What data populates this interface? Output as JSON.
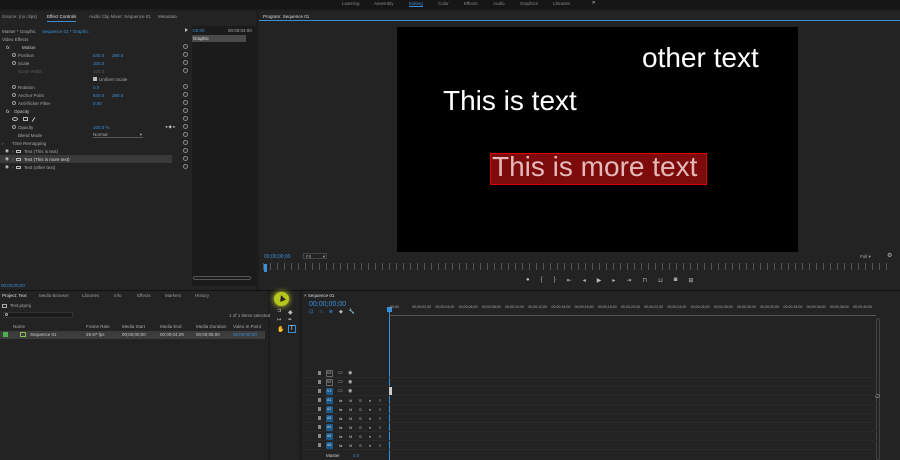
{
  "workspaces": [
    "Learning",
    "Assembly",
    "Editing",
    "Color",
    "Effects",
    "Audio",
    "Graphics",
    "Libraries"
  ],
  "workspaces_more": "»",
  "effect_panel": {
    "tabs": [
      "Source: (no clips)",
      "Effect Controls",
      "Audio Clip Mixer: Sequence 01",
      "Metadata"
    ],
    "master_label": "Master * Graphic",
    "clip_label": "Sequence 01 * Graphic",
    "mini_timecode": ":00:00",
    "mini_timecode_end": "00:00:04:00",
    "mini_clip": "Graphic",
    "section": "Video Effects",
    "motion": "Motion",
    "position": {
      "label": "Position",
      "x": "640.0",
      "y": "360.0"
    },
    "scale": {
      "label": "Scale",
      "value": "100.0"
    },
    "scale_width": {
      "label": "Scale Width",
      "value": "100.0"
    },
    "uniform_scale": "Uniform Scale",
    "rotation": {
      "label": "Rotation",
      "value": "0.0"
    },
    "anchor": {
      "label": "Anchor Point",
      "x": "640.0",
      "y": "360.0"
    },
    "anti_flicker": {
      "label": "Anti-flicker Filter",
      "value": "0.00"
    },
    "opacity": "Opacity",
    "opacity_val": {
      "label": "Opacity",
      "value": "100.0 %"
    },
    "blend": {
      "label": "Blend Mode",
      "value": "Normal"
    },
    "time_remap": "Time Remapping",
    "layers": [
      "Text (This is text)",
      "Text (This is more text)",
      "Text (other text)"
    ],
    "footer_tc": "00;00;00;00"
  },
  "program": {
    "title": "Program: Sequence 01",
    "texts": [
      "other text",
      "This is text",
      "This is more text"
    ],
    "timecode": "00;00;00;00",
    "fit": "Fit",
    "full": "Full"
  },
  "project": {
    "tabs": [
      "Project: Text",
      "Media Browser",
      "Libraries",
      "Info",
      "Effects",
      "Markers",
      "History"
    ],
    "folder": "Text.prproj",
    "selected_info": "1 of 1 items selected",
    "columns": [
      "Name",
      "Frame Rate",
      "Media Start",
      "Media End",
      "Media Duration",
      "Video In Point"
    ],
    "row": [
      "Sequence 01",
      "29.97 fps",
      "00;00;00;00",
      "00;00;04;29",
      "00;00;05;00",
      "00;00;00;00"
    ]
  },
  "timeline": {
    "tab": "Sequence 01",
    "timecode": "00;00;00;00",
    "ruler": [
      ":00;00",
      "00;00;02;00",
      "00;00;04;00",
      "00;00;06;00",
      "00;00;08;00",
      "00;00;10;00",
      "00;00;12;00",
      "00;00;14;00",
      "00;00;16;00",
      "00;00;18;00",
      "00;00;20;00",
      "00;00;22;00",
      "00;00;24;00",
      "00;00;26;00",
      "00;00;28;00",
      "00;00;30;00",
      "00;00;32;00",
      "00;00;34;00",
      "00;00;36;00",
      "00;00;38;00",
      "00;00;40;00"
    ],
    "video_tracks": [
      "V3",
      "V2",
      "V1"
    ],
    "audio_tracks": [
      "A1",
      "A2",
      "A3",
      "A4",
      "A5",
      "A6"
    ],
    "master": "Master",
    "master_val": "0.0"
  },
  "colors": {
    "accent": "#3a8fd9",
    "tool_selected": "#b7c61d",
    "highlight_box": "#7d0b0b"
  }
}
